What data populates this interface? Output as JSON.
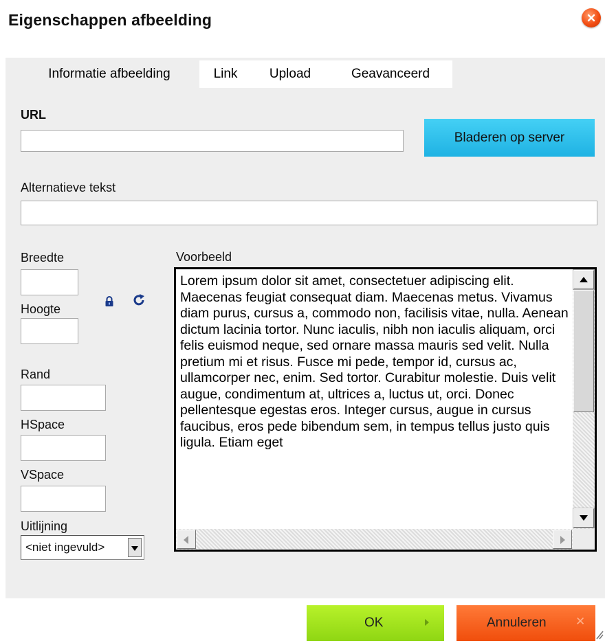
{
  "dialog": {
    "title": "Eigenschappen afbeelding",
    "close_icon": "close-icon",
    "accent_color": "#1fb2e3"
  },
  "tabs": [
    {
      "label": "Informatie afbeelding",
      "active": true
    },
    {
      "label": "Link",
      "active": false
    },
    {
      "label": "Upload",
      "active": false
    },
    {
      "label": "Geavanceerd",
      "active": false
    }
  ],
  "url": {
    "label": "URL",
    "value": "",
    "browse_label": "Bladeren op server"
  },
  "alt": {
    "label": "Alternatieve tekst",
    "value": ""
  },
  "dimensions": {
    "width_label": "Breedte",
    "width_value": "",
    "height_label": "Hoogte",
    "height_value": "",
    "lock_icon": "lock-icon",
    "reset_icon": "reset-size-icon"
  },
  "border": {
    "label": "Rand",
    "value": ""
  },
  "hspace": {
    "label": "HSpace",
    "value": ""
  },
  "vspace": {
    "label": "VSpace",
    "value": ""
  },
  "align": {
    "label": "Uitlijning",
    "selected": "<niet ingevuld>"
  },
  "preview": {
    "label": "Voorbeeld",
    "text": "Lorem ipsum dolor sit amet, consectetuer adipiscing elit. Maecenas feugiat consequat diam. Maecenas metus. Vivamus diam purus, cursus a, commodo non, facilisis vitae, nulla. Aenean dictum lacinia tortor. Nunc iaculis, nibh non iaculis aliquam, orci felis euismod neque, sed ornare massa mauris sed velit. Nulla pretium mi et risus. Fusce mi pede, tempor id, cursus ac, ullamcorper nec, enim. Sed tortor. Curabitur molestie. Duis velit augue, condimentum at, ultrices a, luctus ut, orci. Donec pellentesque egestas eros. Integer cursus, augue in cursus faucibus, eros pede bibendum sem, in tempus tellus justo quis ligula. Etiam eget"
  },
  "footer": {
    "ok_label": "OK",
    "cancel_label": "Annuleren",
    "ok_color": "#9ee01c",
    "cancel_color": "#f5601b"
  }
}
